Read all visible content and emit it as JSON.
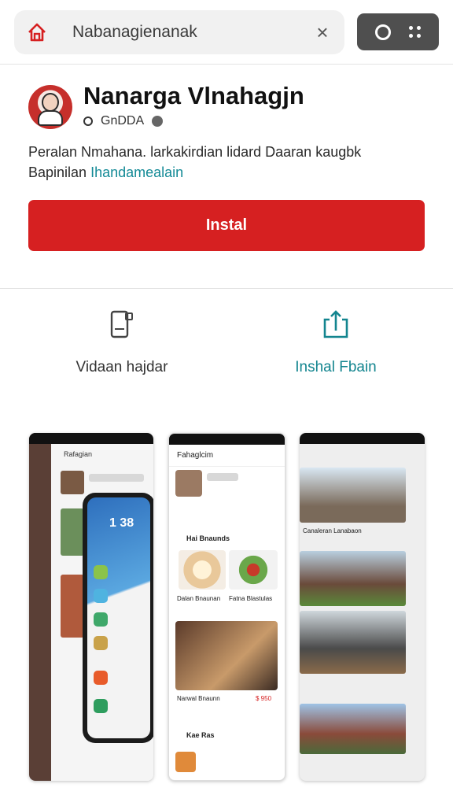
{
  "browser": {
    "url": "Nabanagienanak",
    "home_icon": "home-icon",
    "clear_icon": "close-icon",
    "clear_glyph": "×"
  },
  "app": {
    "title": "Nanarga Vlnahagjn",
    "meta": "GnDDA",
    "description_line1": "Peralan Nmahana. larkakirdian lidard Daaran kaugbk",
    "description_prefix": "Bapinilan",
    "description_link": "Ihandamealain",
    "install_label": "Instal",
    "accent_color": "#d62021",
    "link_color": "#13858f"
  },
  "actions": [
    {
      "label": "Vidaan hajdar",
      "icon": "device-icon"
    },
    {
      "label": "Inshal Fbain",
      "icon": "share-icon"
    }
  ],
  "screenshots": {
    "shot1": {
      "clock": "1 38",
      "header": "Rafagian"
    },
    "shot2": {
      "header": "Fahaglcim",
      "section1": "Hai Bnaunds",
      "caption1": "Dalan Bnaunan",
      "caption2": "Fatna Blastulas",
      "caption3": "Narwal Bnaunn",
      "price": "$ 950",
      "section2": "Kae Ras"
    },
    "shot3": {
      "caption": "Canaleran Lanabaon"
    }
  }
}
